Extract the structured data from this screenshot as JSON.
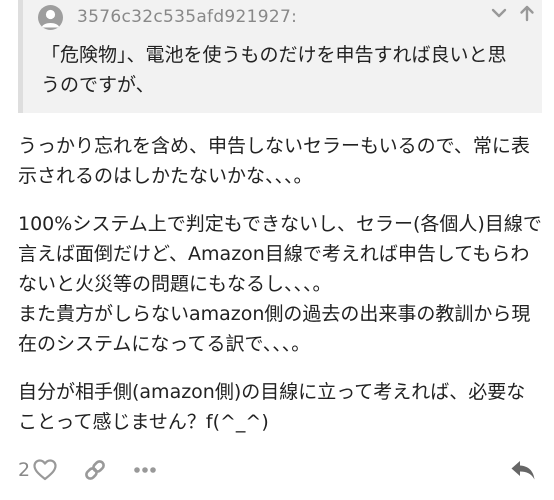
{
  "quote": {
    "author": "3576c32c535afd921927:",
    "text": "「危険物」、電池を使うものだけを申告すれば良いと思うのですが、"
  },
  "post": {
    "paragraphs": [
      "うっかり忘れを含め、申告しないセラーもいるので、常に表示されるのはしかたないかな、、、。",
      "100%システム上で判定もできないし、セラー(各個人)目線で言えば面倒だけど、Amazon目線で考えれば申告してもらわないと火災等の問題にもなるし、、、。\nまた貴方がしらないamazon側の過去の出来事の教訓から現在のシステムになってる訳で、、、。",
      "自分が相手側(amazon側)の目線に立って考えれば、必要なことって感じません？f(^_^)"
    ]
  },
  "actions": {
    "like_count": "2"
  },
  "icons": {
    "avatar": "user-avatar-icon",
    "collapse": "chevron-down-icon",
    "jump": "arrow-up-icon",
    "like": "heart-icon",
    "link": "link-icon",
    "more": "ellipsis-icon",
    "reply": "reply-arrow-icon"
  },
  "colors": {
    "quote_background": "#f2f2f2",
    "quote_border": "#dedede",
    "muted_text": "#888888",
    "body_text": "#222222",
    "icon": "#999999"
  }
}
